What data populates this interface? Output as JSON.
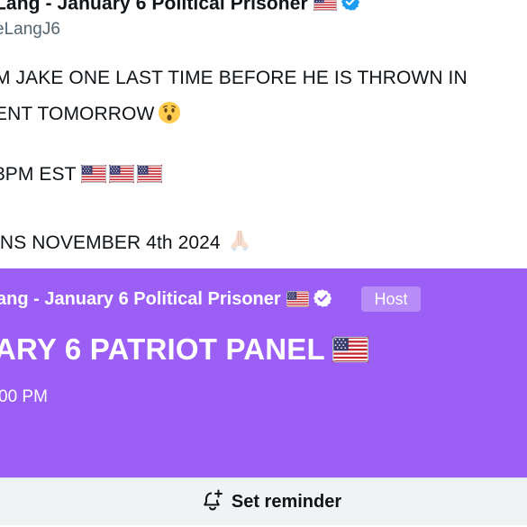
{
  "tweet": {
    "author_name": "Lang - January 6 Political Prisoner",
    "author_flag_icon": "us-flag-icon",
    "verified_icon": "verified-badge-icon",
    "handle": "eLangJ6",
    "body_lines": [
      "M JAKE ONE LAST TIME BEFORE HE IS THROWN IN",
      "ENT TOMORROW",
      "3PM EST",
      "INS NOVEMBER 4th 2024"
    ],
    "face_emoji_icon": "astonished-face-icon",
    "pray_emoji_icon": "folded-hands-icon"
  },
  "space": {
    "host_name": "ang - January 6 Political Prisoner",
    "host_badge": "Host",
    "title": "ARY 6 PATRIOT PANEL",
    "time": "00 PM",
    "background_color": "#9b5ff5"
  },
  "reminder": {
    "label": "Set reminder",
    "icon": "bell-plus-icon"
  },
  "colors": {
    "text_primary": "#0f1419",
    "text_secondary": "#536471",
    "verified_blue": "#1d9bf0",
    "space_purple": "#9b5ff5",
    "reminder_bg": "#eff3f4"
  }
}
